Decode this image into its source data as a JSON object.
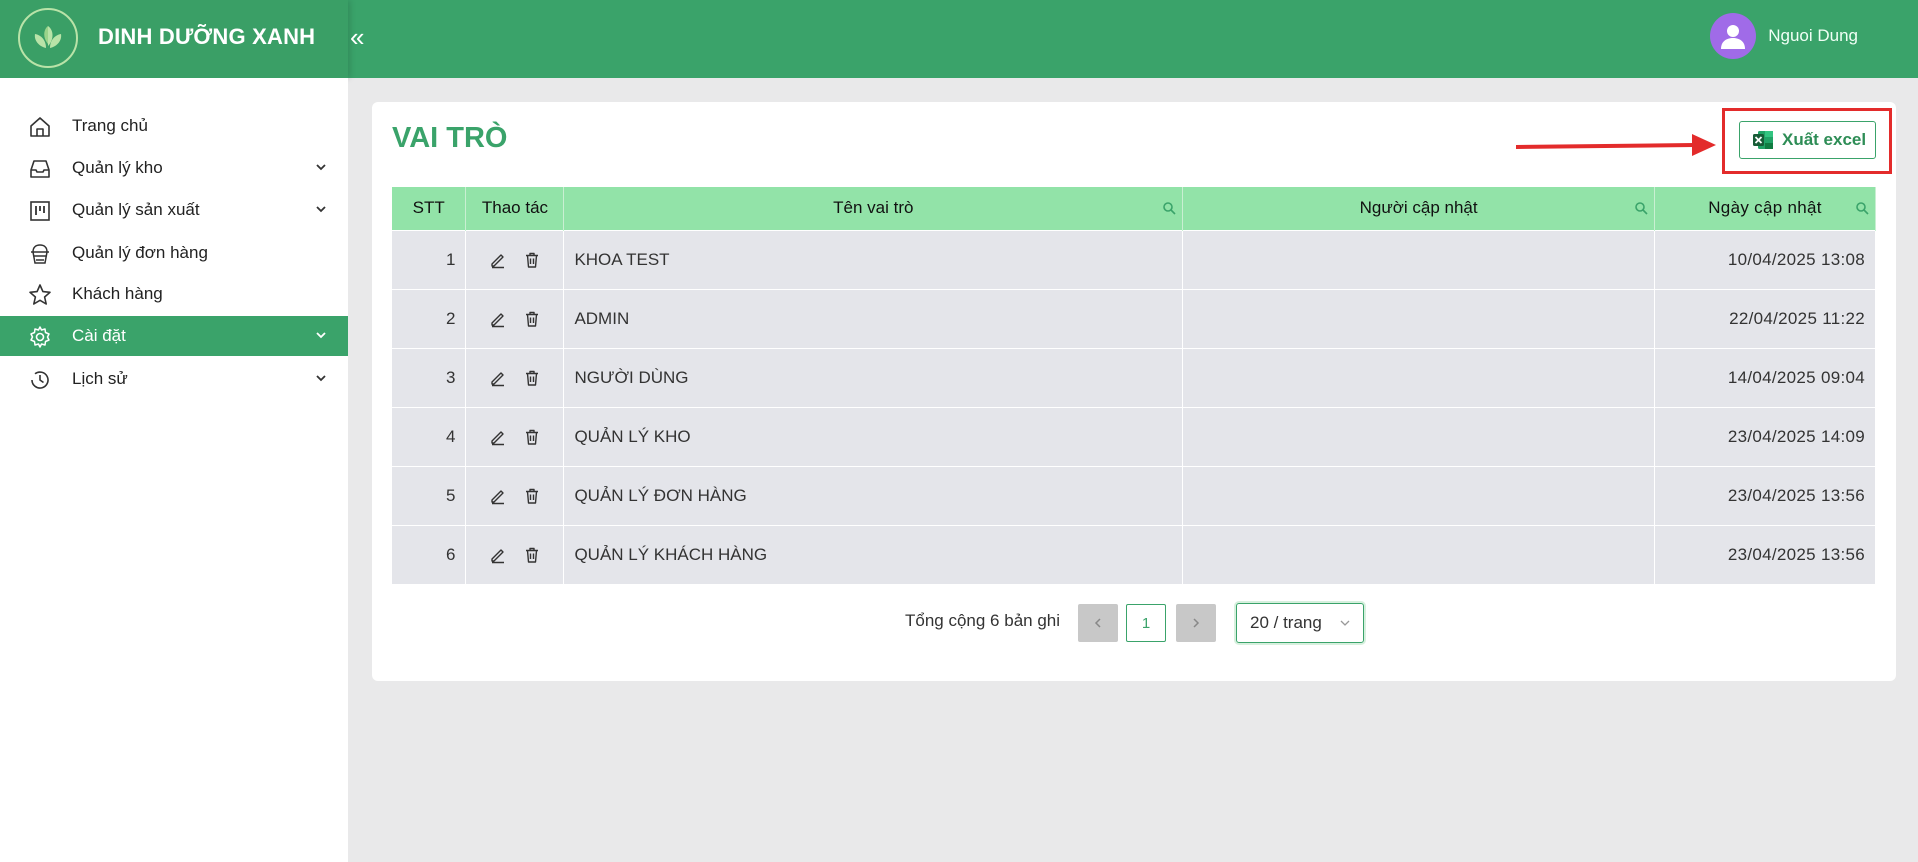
{
  "header": {
    "brand": "DINH DƯỠNG XANH",
    "collapse_icon": "double-chevron-left-icon",
    "user_name": "Nguoi Dung",
    "colors": {
      "primary": "#3aa36a",
      "avatar": "#a06be8"
    }
  },
  "sidebar": {
    "items": [
      {
        "label": "Trang chủ",
        "icon": "home-icon",
        "has_submenu": false,
        "active": false
      },
      {
        "label": "Quản lý kho",
        "icon": "inbox-icon",
        "has_submenu": true,
        "active": false
      },
      {
        "label": "Quản lý sản xuất",
        "icon": "project-icon",
        "has_submenu": true,
        "active": false
      },
      {
        "label": "Quản lý đơn hàng",
        "icon": "order-icon",
        "has_submenu": false,
        "active": false
      },
      {
        "label": "Khách hàng",
        "icon": "star-icon",
        "has_submenu": false,
        "active": false
      },
      {
        "label": "Cài đặt",
        "icon": "gear-icon",
        "has_submenu": true,
        "active": true
      },
      {
        "label": "Lịch sử",
        "icon": "clock-icon",
        "has_submenu": true,
        "active": false
      }
    ]
  },
  "main": {
    "title": "VAI TRÒ",
    "export_button": "Xuất excel",
    "table": {
      "columns": [
        "STT",
        "Thao tác",
        "Tên vai trò",
        "Người cập nhật",
        "Ngày cập nhật"
      ],
      "rows": [
        {
          "stt": "1",
          "name": "KHOA TEST",
          "updated_by": "",
          "updated_at": "10/04/2025 13:08"
        },
        {
          "stt": "2",
          "name": "ADMIN",
          "updated_by": "",
          "updated_at": "22/04/2025 11:22"
        },
        {
          "stt": "3",
          "name": "NGƯỜI DÙNG",
          "updated_by": "",
          "updated_at": "14/04/2025 09:04"
        },
        {
          "stt": "4",
          "name": "QUẢN LÝ KHO",
          "updated_by": "",
          "updated_at": "23/04/2025 14:09"
        },
        {
          "stt": "5",
          "name": "QUẢN LÝ ĐƠN HÀNG",
          "updated_by": "",
          "updated_at": "23/04/2025 13:56"
        },
        {
          "stt": "6",
          "name": "QUẢN LÝ KHÁCH HÀNG",
          "updated_by": "",
          "updated_at": "23/04/2025 13:56"
        }
      ]
    },
    "pagination": {
      "total": "Tổng cộng 6 bản ghi",
      "current_page": "1",
      "page_size": "20 / trang"
    }
  }
}
